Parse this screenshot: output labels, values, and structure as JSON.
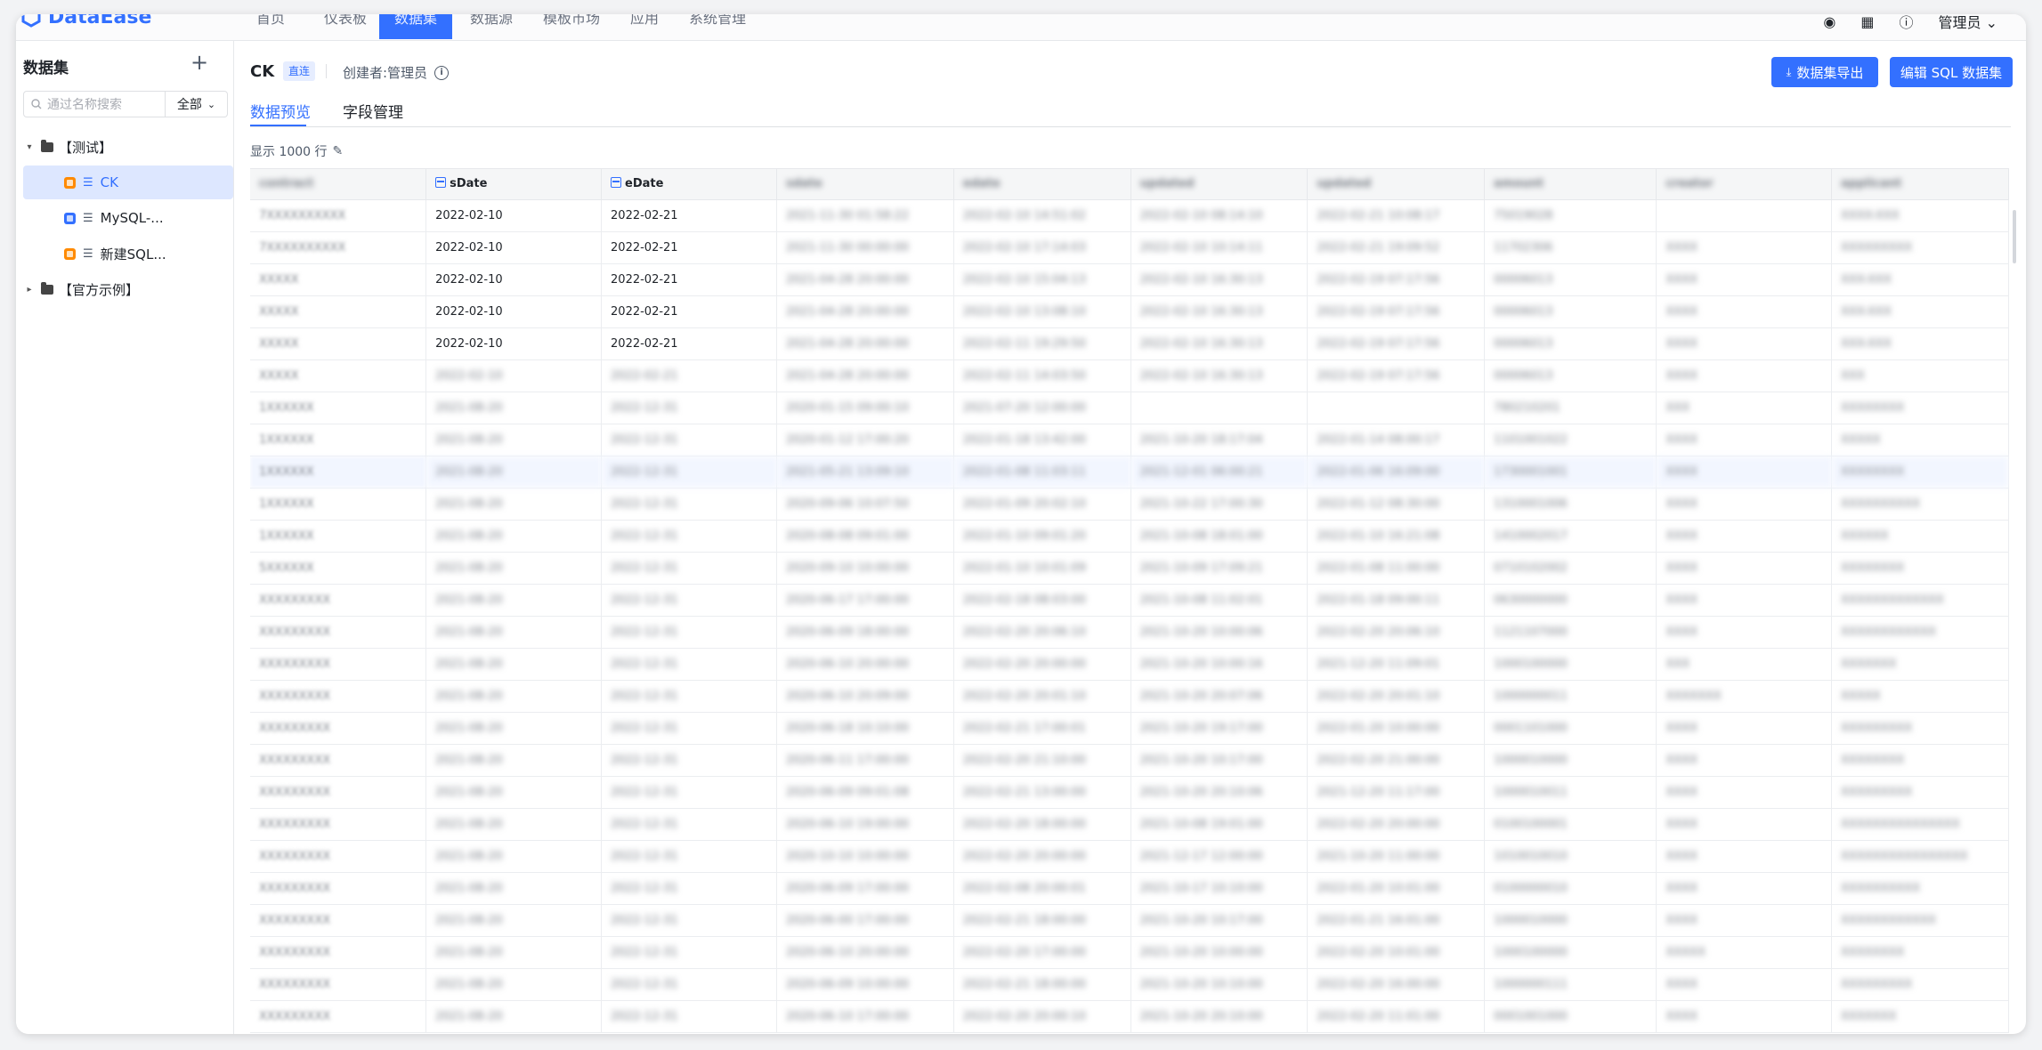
{
  "app": {
    "logo_text": "DataEase"
  },
  "nav": {
    "items": [
      "首页",
      "仪表板",
      "数据集",
      "数据源",
      "模板市场",
      "应用",
      "系统管理"
    ],
    "active_index": 2,
    "user": "管理员"
  },
  "sidebar": {
    "title": "数据集",
    "search_placeholder": "通过名称搜索",
    "filter_label": "全部",
    "tree": [
      {
        "label": "【测试】",
        "type": "folder",
        "expanded": true
      },
      {
        "label": "CK",
        "type": "dataset",
        "badge": "orange",
        "selected": true
      },
      {
        "label": "MySQL-...",
        "type": "dataset",
        "badge": "blue"
      },
      {
        "label": "新建SQL...",
        "type": "dataset",
        "badge": "orange"
      },
      {
        "label": "【官方示例】",
        "type": "folder",
        "expanded": false
      }
    ]
  },
  "header": {
    "dataset_name": "CK",
    "mode_badge": "直连",
    "creator": "创建者:管理员",
    "export_button": "数据集导出",
    "edit_button": "编辑 SQL 数据集"
  },
  "tabs": [
    "数据预览",
    "字段管理"
  ],
  "preview": {
    "rows_label": "显示 1000 行"
  },
  "table": {
    "columns": [
      "contract",
      "sDate",
      "eDate",
      "sdate",
      "edate",
      "updated",
      "updated",
      "amount",
      "creator",
      "applicant"
    ],
    "rows": [
      [
        "7XXXXXXXXXX",
        "2022-02-10",
        "2022-02-21",
        "2021-11-30 01:58:22",
        "2022-02-10 14:51:02",
        "2022-02-10 08:14:10",
        "2022-02-21 10:08:17",
        "75019028",
        "",
        "XXXX-XXX"
      ],
      [
        "7XXXXXXXXXX",
        "2022-02-10",
        "2022-02-21",
        "2021-11-30 00:00:00",
        "2022-02-10 17:14:03",
        "2022-02-10 10:14:11",
        "2022-02-21 19:09:52",
        "11702306",
        "XXXX",
        "XXXXXXXXX"
      ],
      [
        "XXXXX",
        "2022-02-10",
        "2022-02-21",
        "2021-04-28 20:00:00",
        "2022-02-10 15:04:13",
        "2022-02-10 16:30:13",
        "2022-02-19 07:17:56",
        "00006013",
        "XXXX",
        "XXX-XXX"
      ],
      [
        "XXXXX",
        "2022-02-10",
        "2022-02-21",
        "2021-04-28 20:00:00",
        "2022-02-10 13:08:10",
        "2022-02-10 16:30:13",
        "2022-02-19 07:17:56",
        "00006013",
        "XXXX",
        "XXX-XXX"
      ],
      [
        "XXXXX",
        "2022-02-10",
        "2022-02-21",
        "2021-04-28 20:00:00",
        "2022-02-11 19:29:50",
        "2022-02-10 16:30:13",
        "2022-02-19 07:17:56",
        "00006013",
        "XXXX",
        "XXX-XXX"
      ],
      [
        "XXXXX",
        "2022-02-10",
        "2022-02-21",
        "2021-04-28 20:00:00",
        "2022-02-11 14:03:50",
        "2022-02-10 16:30:13",
        "2022-02-19 07:17:56",
        "00006013",
        "XXXX",
        "XXX"
      ],
      [
        "1XXXXXX",
        "2021-08-20",
        "2022-12-31",
        "2020-01-15 09:00:10",
        "2021-07-20 12:00:00",
        "",
        "",
        "780210201",
        "XXX",
        "XXXXXXXX"
      ],
      [
        "1XXXXXX",
        "2021-08-20",
        "2022-12-31",
        "2020-01-12 17:00:20",
        "2022-01-18 13:42:00",
        "2021-10-20 18:17:04",
        "2022-01-14 08:00:17",
        "1101001022",
        "XXXX",
        "XXXXX"
      ],
      [
        "1XXXXXX",
        "2021-08-20",
        "2022-12-31",
        "2021-05-21 13:09:10",
        "2022-01-08 11:03:11",
        "2021-12-01 06:00:21",
        "2022-01-06 16:09:00",
        "1730001001",
        "XXXX",
        "XXXXXXXX"
      ],
      [
        "1XXXXXX",
        "2021-08-20",
        "2022-12-31",
        "2020-09-06 10:07:50",
        "2022-01-09 20:02:10",
        "2021-10-22 17:00:30",
        "2022-01-12 08:30:00",
        "1310001006",
        "XXXX",
        "XXXXXXXXXX"
      ],
      [
        "1XXXXXX",
        "2021-08-20",
        "2022-12-31",
        "2020-08-08 09:01:00",
        "2022-01-10 09:01:20",
        "2021-10-08 18:01:00",
        "2022-01-10 16:21:08",
        "1410002017",
        "XXXX",
        "XXXXXX"
      ],
      [
        "5XXXXXX",
        "2021-08-20",
        "2022-12-31",
        "2020-09-10 10:00:00",
        "2022-01-10 10:01:09",
        "2021-10-09 17:09:21",
        "2022-01-08 11:00:00",
        "0710102002",
        "XXXX",
        "XXXXXXXX"
      ],
      [
        "XXXXXXXXX",
        "2021-08-20",
        "2022-12-31",
        "2020-06-17 17:00:00",
        "2022-02-18 08:03:00",
        "2021-10-08 11:02:01",
        "2022-01-18 09:00:11",
        "0630000000",
        "XXXX",
        "XXXXXXXXXXXXX"
      ],
      [
        "XXXXXXXXX",
        "2021-08-20",
        "2022-12-31",
        "2020-06-09 18:00:00",
        "2022-02-20 20:06:10",
        "2021-10-20 10:00:06",
        "2022-02-20 20:06:10",
        "1121107000",
        "XXXX",
        "XXXXXXXXXXXX"
      ],
      [
        "XXXXXXXXX",
        "2021-08-20",
        "2022-12-31",
        "2020-06-10 20:00:00",
        "2022-02-20 20:00:00",
        "2021-10-20 10:00:16",
        "2021-12-20 11:09:01",
        "1000100000",
        "XXX",
        "XXXXXXX"
      ],
      [
        "XXXXXXXXX",
        "2021-08-20",
        "2022-12-31",
        "2020-06-10 20:09:00",
        "2022-02-20 20:01:10",
        "2021-10-20 20:07:06",
        "2022-02-20 20:01:10",
        "1000000011",
        "XXXXXXX",
        "XXXXX"
      ],
      [
        "XXXXXXXXX",
        "2021-08-20",
        "2022-12-31",
        "2020-06-18 10:10:00",
        "2022-02-21 17:00:01",
        "2021-10-20 19:17:00",
        "2022-01-20 10:00:00",
        "0001101000",
        "XXXX",
        "XXXXXXXXX"
      ],
      [
        "XXXXXXXXX",
        "2021-08-20",
        "2022-12-31",
        "2020-06-11 17:00:00",
        "2022-02-20 21:10:00",
        "2021-10-20 10:17:00",
        "2022-02-20 21:00:00",
        "1000010000",
        "XXXX",
        "XXXXXXXX"
      ],
      [
        "XXXXXXXXX",
        "2021-08-20",
        "2022-12-31",
        "2020-06-09 09:01:08",
        "2022-02-21 13:00:00",
        "2021-10-20 20:10:06",
        "2021-12-20 11:17:00",
        "1000010011",
        "XXXX",
        "XXXXXXXXX"
      ],
      [
        "XXXXXXXXX",
        "2021-08-20",
        "2022-12-31",
        "2020-06-10 19:00:00",
        "2022-02-20 18:00:00",
        "2021-10-08 19:01:00",
        "2022-02-20 20:00:00",
        "0100100001",
        "XXXX",
        "XXXXXXXXXXXXXXX"
      ],
      [
        "XXXXXXXXX",
        "2021-08-20",
        "2022-12-31",
        "2020-10-10 10:00:00",
        "2022-02-20 20:00:00",
        "2021-12-17 12:00:00",
        "2021-10-20 11:00:00",
        "1010010010",
        "XXXX",
        "XXXXXXXXXXXXXXXX"
      ],
      [
        "XXXXXXXXX",
        "2021-08-20",
        "2022-12-31",
        "2020-06-09 17:00:00",
        "2022-02-08 20:00:01",
        "2021-10-17 10:10:00",
        "2022-01-20 10:01:00",
        "0100000010",
        "XXXX",
        "XXXXXXXXXX"
      ],
      [
        "XXXXXXXXX",
        "2021-08-20",
        "2022-12-31",
        "2020-06-00 17:00:00",
        "2022-02-21 18:00:00",
        "2021-10-20 10:17:00",
        "2022-01-21 16:01:00",
        "1000010000",
        "XXXX",
        "XXXXXXXXXXXX"
      ],
      [
        "XXXXXXXXX",
        "2021-08-20",
        "2022-12-31",
        "2020-06-10 20:00:00",
        "2022-02-20 17:00:00",
        "2021-10-20 10:00:00",
        "2022-02-20 10:01:00",
        "1000100000",
        "XXXXX",
        "XXXXXXXX"
      ],
      [
        "XXXXXXXXX",
        "2021-08-20",
        "2022-12-31",
        "2020-06-09 10:00:00",
        "2022-02-21 18:00:00",
        "2021-10-20 10:10:00",
        "2022-02-20 16:00:00",
        "1000000111",
        "XXXX",
        "XXXXXXXXX"
      ],
      [
        "XXXXXXXXX",
        "2021-08-20",
        "2022-12-31",
        "2020-06-10 17:00:00",
        "2022-02-20 20:00:10",
        "2021-10-20 20:10:00",
        "2022-02-20 11:01:00",
        "0001001000",
        "XXXX",
        "XXXXXXX"
      ]
    ]
  }
}
